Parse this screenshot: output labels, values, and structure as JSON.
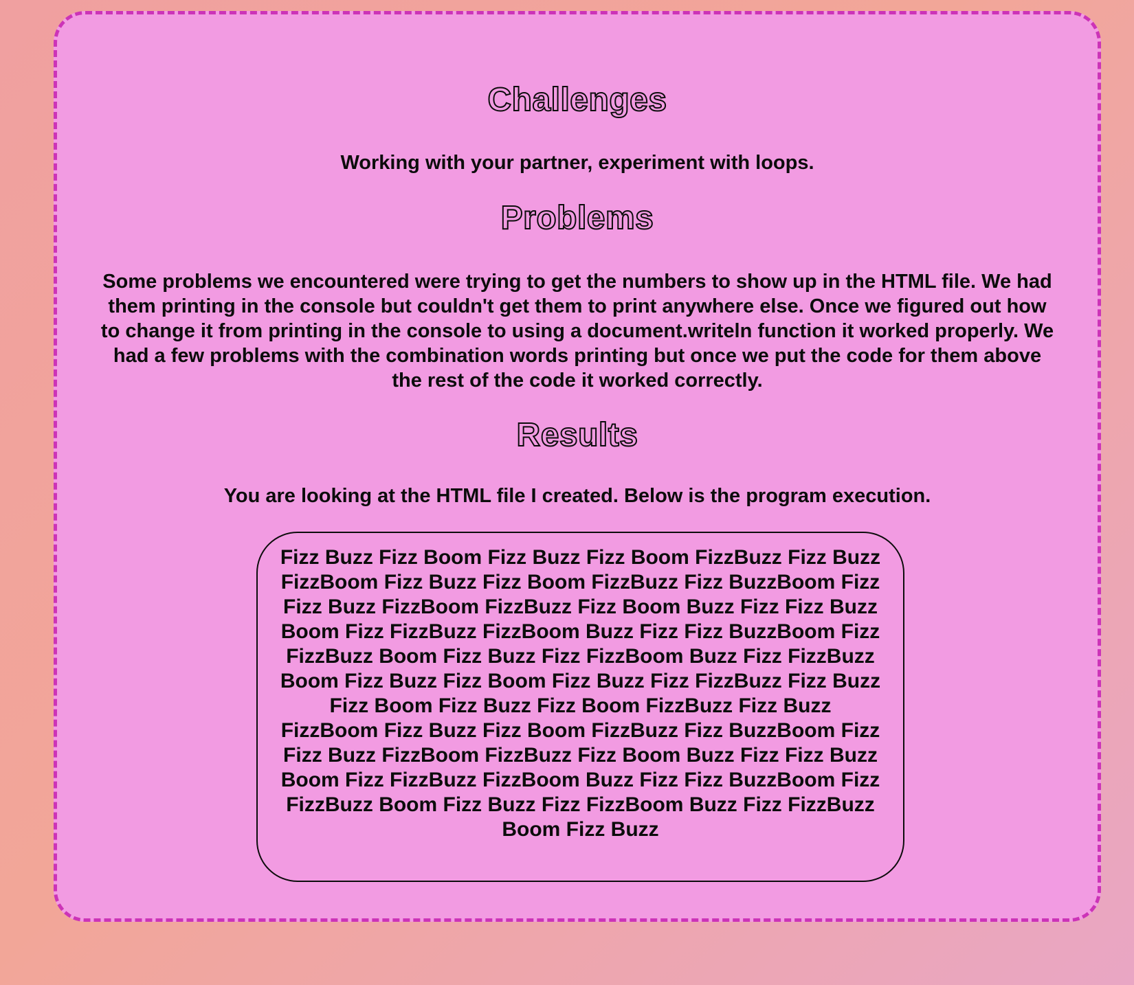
{
  "challenges": {
    "title": "Challenges",
    "text": "Working with your partner, experiment with loops."
  },
  "problems": {
    "title": "Problems",
    "text": "Some problems we encountered were trying to get the numbers to show up in the HTML file. We had them printing in the console but couldn't get them to print anywhere else. Once we figured out how to change it from printing in the console to using a document.writeln function it worked properly. We had a few problems with the combination words printing but once we put the code for them above the rest of the code it worked correctly."
  },
  "results": {
    "title": "Results",
    "text": "You are looking at the HTML file I created. Below is the program execution.",
    "output": "Fizz Buzz Fizz Boom Fizz Buzz Fizz Boom FizzBuzz Fizz Buzz FizzBoom Fizz Buzz Fizz Boom FizzBuzz Fizz BuzzBoom Fizz Fizz Buzz FizzBoom FizzBuzz Fizz Boom Buzz Fizz Fizz Buzz Boom Fizz FizzBuzz FizzBoom Buzz Fizz Fizz BuzzBoom Fizz FizzBuzz Boom Fizz Buzz Fizz FizzBoom Buzz Fizz FizzBuzz Boom Fizz Buzz Fizz Boom Fizz Buzz Fizz FizzBuzz Fizz Buzz Fizz Boom Fizz Buzz Fizz Boom FizzBuzz Fizz Buzz FizzBoom Fizz Buzz Fizz Boom FizzBuzz Fizz BuzzBoom Fizz Fizz Buzz FizzBoom FizzBuzz Fizz Boom Buzz Fizz Fizz Buzz Boom Fizz FizzBuzz FizzBoom Buzz Fizz Fizz BuzzBoom Fizz FizzBuzz Boom Fizz Buzz Fizz FizzBoom Buzz Fizz FizzBuzz Boom Fizz Buzz"
  },
  "colors": {
    "background_start": "#f0a0a0",
    "background_end": "#e9a6c4",
    "card": "#f29be2",
    "card_border": "#cc33b8",
    "text": "#0c0c0c"
  }
}
